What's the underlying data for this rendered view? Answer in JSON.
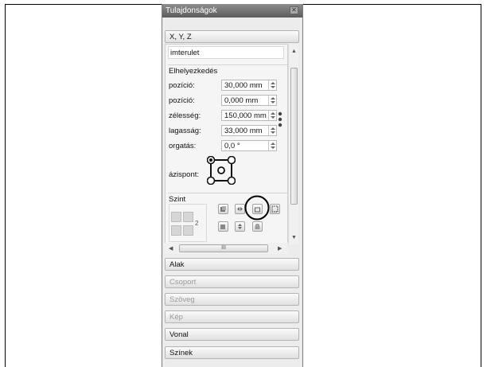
{
  "panel": {
    "title": "Tulajdonságok",
    "sections": {
      "xyz": "X, Y, Z",
      "alak": "Alak",
      "csoport": "Csoport",
      "szoveg": "Szöveg",
      "kep": "Kép",
      "vonal": "Vonal",
      "szinek": "Színek"
    },
    "name_value": "imterulet",
    "elhelyezkedes": {
      "heading": "Elhelyezkedés",
      "rows": [
        {
          "label": "pozíció:",
          "value": "30,000 mm"
        },
        {
          "label": "pozíció:",
          "value": "0,000 mm"
        },
        {
          "label": "zélesség:",
          "value": "150,000 mm"
        },
        {
          "label": "lagasság:",
          "value": "33,000 mm"
        },
        {
          "label": "orgatás:",
          "value": "0,0 °"
        }
      ],
      "anchor_label": "ázispont:"
    },
    "szint": {
      "heading": "Szint",
      "number": "2"
    },
    "hscroll_grip": "III"
  }
}
